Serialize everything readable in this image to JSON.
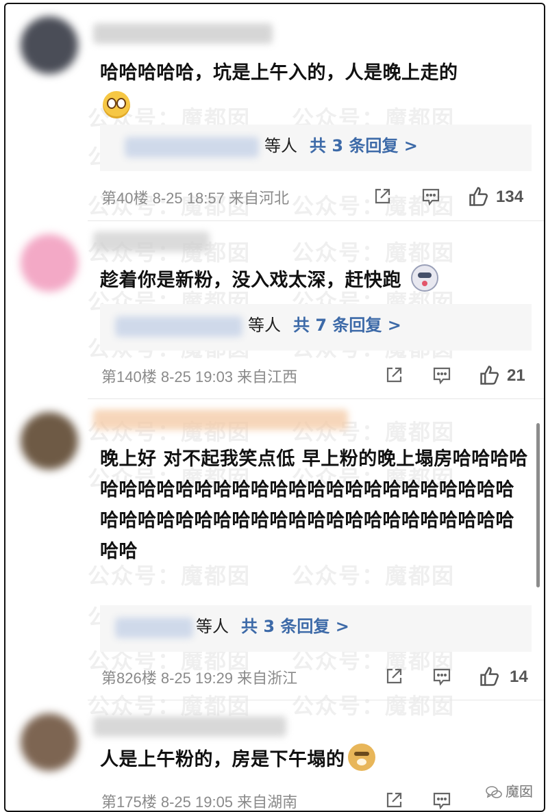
{
  "watermark_text": "公众号：魔都囡",
  "brand": {
    "label": "魔囡",
    "icon": "wechat-icon"
  },
  "comments": [
    {
      "text": "哈哈哈哈哈，坑是上午入的，人是晚上走的",
      "emoji": "shocked-face-emoji",
      "replies": {
        "who": "等人",
        "link": "共 3 条回复 >"
      },
      "floor": "第40楼",
      "time": "8-25 18:57",
      "location": "来自河北",
      "likes": "134"
    },
    {
      "text": "趁着你是新粉，没入戏太深，赶快跑",
      "emoji": "dog-face-emoji",
      "replies": {
        "who": "等人",
        "link": "共 7 条回复 >"
      },
      "floor": "第140楼",
      "time": "8-25 19:03",
      "location": "来自江西",
      "likes": "21"
    },
    {
      "text": "晚上好 对不起我笑点低 早上粉的晚上塌房哈哈哈哈哈哈哈哈哈哈哈哈哈哈哈哈哈哈哈哈哈哈哈哈哈哈哈哈哈哈哈哈哈哈哈哈哈哈哈哈哈哈哈哈哈哈哈哈哈哈",
      "emoji": "",
      "replies": {
        "who": "等人",
        "link": "共 3 条回复 >"
      },
      "floor": "第826楼",
      "time": "8-25 19:29",
      "location": "来自浙江",
      "likes": "14"
    },
    {
      "text": "人是上午粉的，房是下午塌的",
      "emoji": "doge-emoji",
      "floor": "第175楼",
      "time": "8-25 19:05",
      "location": "来自湖南"
    }
  ]
}
